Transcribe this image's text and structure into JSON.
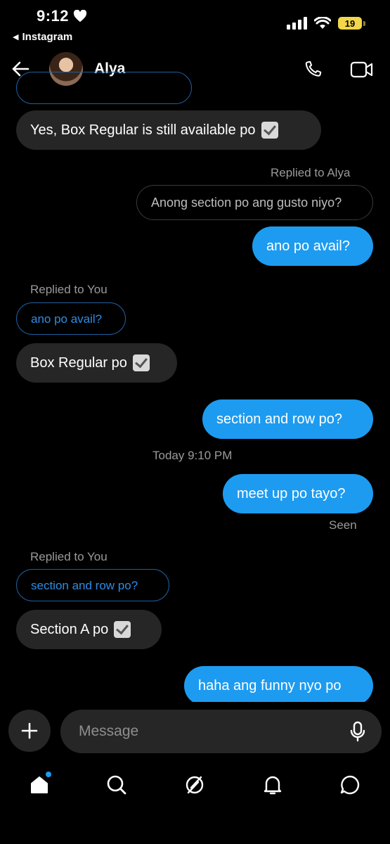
{
  "status_bar": {
    "time": "9:12",
    "back_app": "Instagram",
    "battery": "19"
  },
  "header": {
    "name": "Alya"
  },
  "messages": {
    "m1": "Yes, Box Regular is still available po",
    "reply_label_alya": "Replied to Alya",
    "quoted_1": "Anong section po ang gusto niyo?",
    "m2": "ano po avail?",
    "reply_label_you_1": "Replied to You",
    "quoted_2": "ano po avail?",
    "m3": "Box Regular po",
    "m4": "section and row po?",
    "timestamp": "Today 9:10 PM",
    "m5": "meet up po tayo?",
    "seen": "Seen",
    "reply_label_you_2": "Replied to You",
    "quoted_3": "section and row po?",
    "m6": "Section A po",
    "m7": "haha ang funny nyo po"
  },
  "composer": {
    "placeholder": "Message"
  },
  "nav": [
    "home-icon",
    "search-icon",
    "explore-icon",
    "notifications-icon",
    "messages-icon"
  ],
  "colors": {
    "accent": "#1d9bf0",
    "bubble_in": "#262626",
    "background": "#000000"
  }
}
